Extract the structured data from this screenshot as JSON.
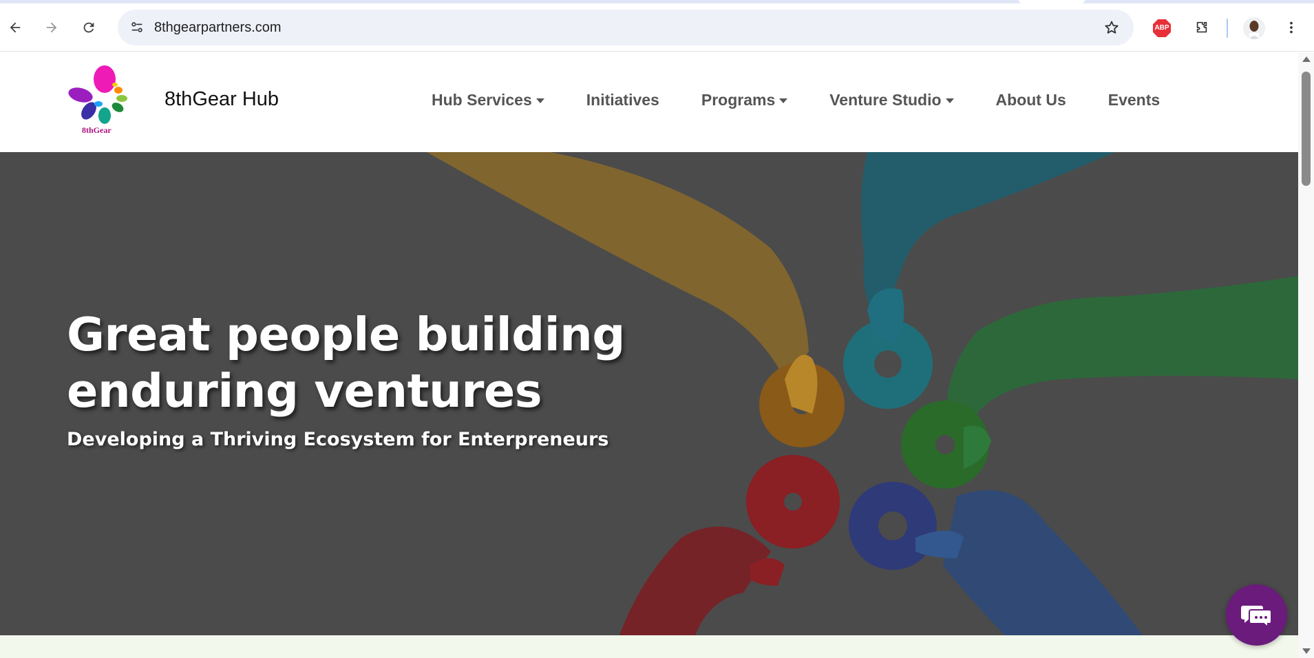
{
  "browser": {
    "url": "8thgearpartners.com",
    "icons": {
      "back": "back-arrow-icon",
      "forward": "forward-arrow-icon",
      "reload": "reload-icon",
      "site_info": "site-info-icon",
      "bookmark": "star-icon",
      "adblock": "adblock-plus-icon",
      "extensions": "puzzle-icon",
      "menu": "kebab-menu-icon"
    },
    "adblock_label": "ABP"
  },
  "site": {
    "logo_text": "8thGear",
    "brand": "8thGear Hub",
    "nav": [
      {
        "label": "Hub Services",
        "dropdown": true
      },
      {
        "label": "Initiatives",
        "dropdown": false
      },
      {
        "label": "Programs",
        "dropdown": true
      },
      {
        "label": "Venture Studio",
        "dropdown": true
      },
      {
        "label": "About Us",
        "dropdown": false
      },
      {
        "label": "Events",
        "dropdown": false
      }
    ]
  },
  "hero": {
    "title": "Great people building enduring ventures",
    "subtitle": "Developing a Thriving Ecosystem for Enterpreneurs"
  },
  "chat": {
    "icon": "chat-bubbles-icon",
    "color": "#6a1b7c"
  }
}
